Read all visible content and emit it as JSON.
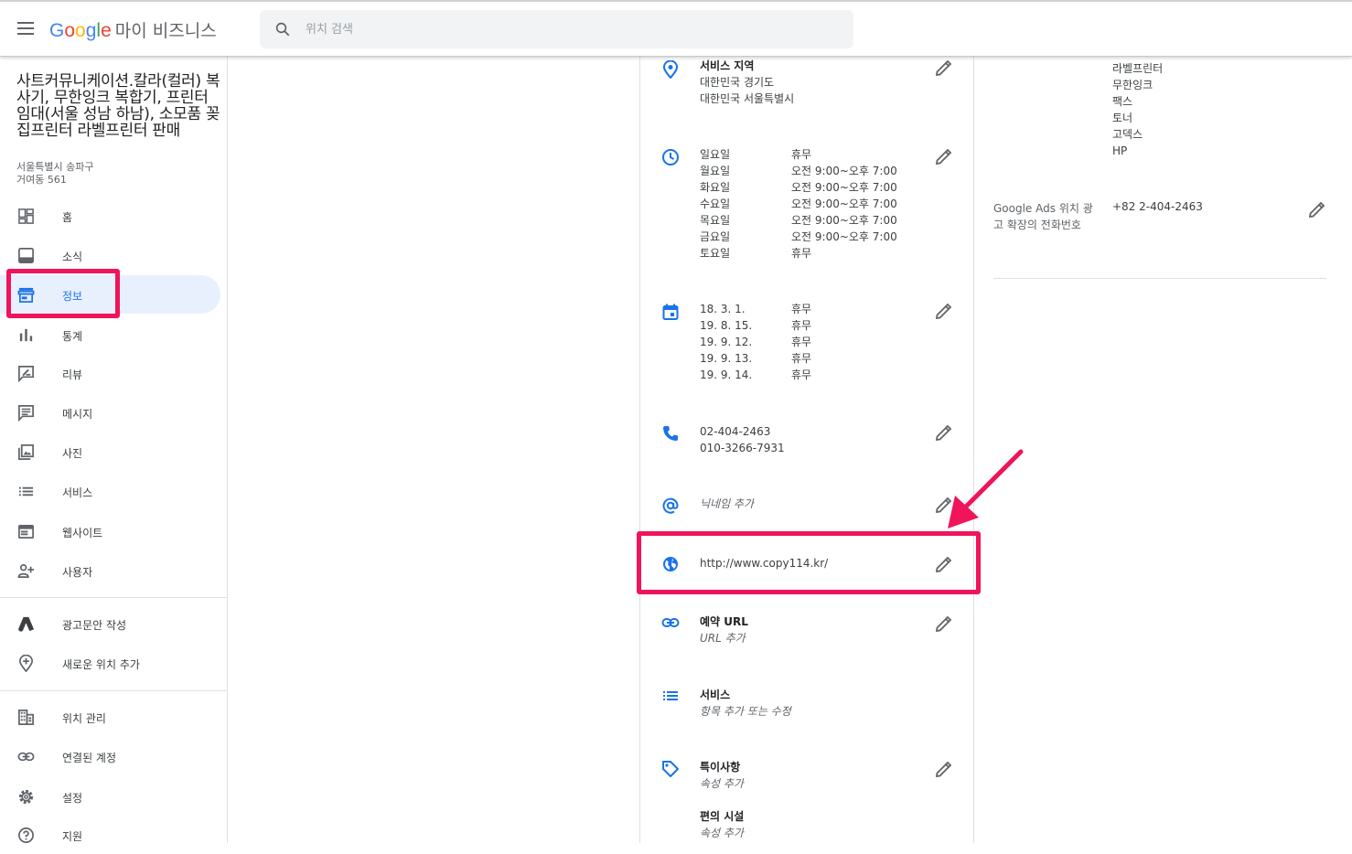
{
  "header": {
    "brand_letters": [
      "G",
      "o",
      "o",
      "g",
      "l",
      "e"
    ],
    "product": "마이 비즈니스",
    "search_placeholder": "위치 검색"
  },
  "business": {
    "name": "사트커뮤니케이션.칼라(컬러) 복사기, 무한잉크 복합기, 프린터 임대(서울 성남 하남), 소모품 꽂집프린터 라벨프린터 판매",
    "address_line1": "서울특별시 송파구",
    "address_line2": "거여동 561"
  },
  "sidebar": {
    "items": [
      {
        "label": "홈",
        "icon": "dashboard-icon"
      },
      {
        "label": "소식",
        "icon": "posts-icon"
      },
      {
        "label": "정보",
        "icon": "storefront-icon",
        "active": true
      },
      {
        "label": "통계",
        "icon": "bar-chart-icon"
      },
      {
        "label": "리뷰",
        "icon": "review-icon"
      },
      {
        "label": "메시지",
        "icon": "message-icon"
      },
      {
        "label": "사진",
        "icon": "photo-icon"
      },
      {
        "label": "서비스",
        "icon": "list-icon"
      },
      {
        "label": "웹사이트",
        "icon": "web-icon"
      },
      {
        "label": "사용자",
        "icon": "person-add-icon"
      }
    ],
    "secondary": [
      {
        "label": "광고문안 작성",
        "icon": "google-ads-icon"
      },
      {
        "label": "새로운 위치 추가",
        "icon": "add-location-icon"
      }
    ],
    "tertiary": [
      {
        "label": "위치 관리",
        "icon": "building-icon"
      },
      {
        "label": "연결된 계정",
        "icon": "link-icon"
      },
      {
        "label": "설정",
        "icon": "settings-icon"
      },
      {
        "label": "지원",
        "icon": "help-icon"
      }
    ]
  },
  "info": {
    "service_area": {
      "title": "서비스 지역",
      "lines": [
        "대한민국 경기도",
        "대한민국 서울특별시"
      ]
    },
    "hours": [
      {
        "day": "일요일",
        "time": "휴무"
      },
      {
        "day": "월요일",
        "time": "오전 9:00~오후 7:00"
      },
      {
        "day": "화요일",
        "time": "오전 9:00~오후 7:00"
      },
      {
        "day": "수요일",
        "time": "오전 9:00~오후 7:00"
      },
      {
        "day": "목요일",
        "time": "오전 9:00~오후 7:00"
      },
      {
        "day": "금요일",
        "time": "오전 9:00~오후 7:00"
      },
      {
        "day": "토요일",
        "time": "휴무"
      }
    ],
    "special_hours": [
      {
        "date": "18. 3. 1.",
        "status": "휴무"
      },
      {
        "date": "19. 8. 15.",
        "status": "휴무"
      },
      {
        "date": "19. 9. 12.",
        "status": "휴무"
      },
      {
        "date": "19. 9. 13.",
        "status": "휴무"
      },
      {
        "date": "19. 9. 14.",
        "status": "휴무"
      }
    ],
    "phones": [
      "02-404-2463",
      "010-3266-7931"
    ],
    "nickname": "닉네임 추가",
    "website": "http://www.copy114.kr/",
    "booking": {
      "title": "예약 URL",
      "value": "URL 추가"
    },
    "services": {
      "title": "서비스",
      "value": "항목 추가 또는 수정"
    },
    "attributes": {
      "title": "특이사항",
      "value": "속성 추가"
    },
    "amenities": {
      "title": "편의 시설",
      "value": "속성 추가"
    }
  },
  "right_panel": {
    "products": [
      "라벨프린터",
      "무한잉크",
      "팩스",
      "토너",
      "고덱스",
      "HP"
    ],
    "ads_phone_label": "Google Ads 위치 광고 확장의 전화번호",
    "ads_phone_value": "+82 2-404-2463"
  },
  "colors": {
    "accent": "#1a73e8",
    "highlight": "#f0145a",
    "icon_blue": "#1a73e8",
    "icon_gray": "#5f6368"
  }
}
